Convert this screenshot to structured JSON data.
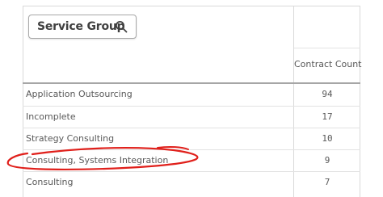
{
  "filter": {
    "label": "Service Group",
    "icon": "search-icon"
  },
  "table": {
    "columns": [
      "Contract Count"
    ],
    "rows": [
      {
        "name": "Application Outsourcing",
        "count": "94"
      },
      {
        "name": "Incomplete",
        "count": "17"
      },
      {
        "name": "Strategy Consulting",
        "count": "10"
      },
      {
        "name": "Consulting, Systems Integration",
        "count": "9"
      },
      {
        "name": "Consulting",
        "count": "7"
      }
    ]
  },
  "annotation": {
    "color": "#e0201b",
    "target_row": "Consulting, Systems Integration"
  }
}
